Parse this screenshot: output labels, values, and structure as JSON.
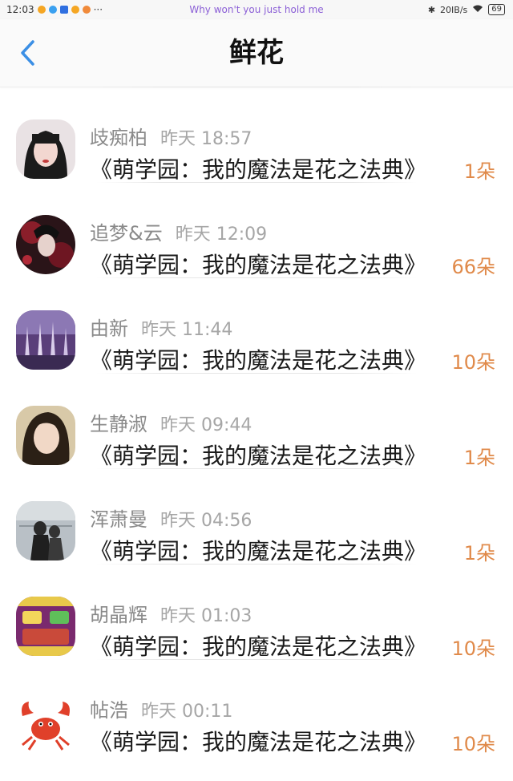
{
  "status_bar": {
    "time": "12:03",
    "more": "···",
    "now_playing": "Why won't you just hold me",
    "net_speed": "20IB/s",
    "battery": "69"
  },
  "nav": {
    "back_icon": "chevron-left-icon",
    "title": "鲜花"
  },
  "colors": {
    "accent_blue": "#3b8fe5",
    "count_orange": "#e08a4a",
    "name_gray": "#8a8a8a",
    "now_playing_purple": "#8b5fd6"
  },
  "items": [
    {
      "name": "歧痴柏",
      "time": "昨天 18:57",
      "gift": "《萌学园：我的魔法是花之法典》",
      "count": "1朵"
    },
    {
      "name": "追梦&云",
      "time": "昨天 12:09",
      "gift": "《萌学园：我的魔法是花之法典》",
      "count": "66朵"
    },
    {
      "name": "由新",
      "time": "昨天 11:44",
      "gift": "《萌学园：我的魔法是花之法典》",
      "count": "10朵"
    },
    {
      "name": "生静淑",
      "time": "昨天 09:44",
      "gift": "《萌学园：我的魔法是花之法典》",
      "count": "1朵"
    },
    {
      "name": "浑萧曼",
      "time": "昨天 04:56",
      "gift": "《萌学园：我的魔法是花之法典》",
      "count": "1朵"
    },
    {
      "name": "胡晶辉",
      "time": "昨天 01:03",
      "gift": "《萌学园：我的魔法是花之法典》",
      "count": "10朵"
    },
    {
      "name": "帖浩",
      "time": "昨天 00:11",
      "gift": "《萌学园：我的魔法是花之法典》",
      "count": "10朵"
    }
  ]
}
